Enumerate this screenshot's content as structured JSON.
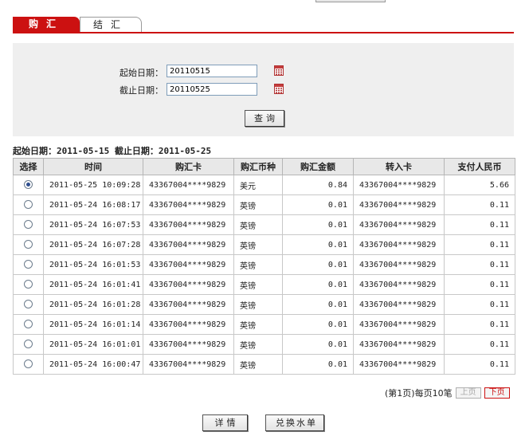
{
  "tabs": [
    {
      "label": "购汇",
      "active": true
    },
    {
      "label": "结汇",
      "active": false
    }
  ],
  "query": {
    "start_label": "起始日期：",
    "start_value": "20110515",
    "end_label": "截止日期：",
    "end_value": "20110525",
    "query_button": "查询"
  },
  "summary": {
    "start_label": "起始日期：",
    "start_value": "2011-05-15",
    "end_label": "截止日期：",
    "end_value": "2011-05-25"
  },
  "table": {
    "headers": [
      "选择",
      "时间",
      "购汇卡",
      "购汇币种",
      "购汇金额",
      "转入卡",
      "支付人民币"
    ],
    "rows": [
      {
        "selected": true,
        "time": "2011-05-25 10:09:28",
        "card": "43367004****9829",
        "currency": "美元",
        "amount": "0.84",
        "to_card": "43367004****9829",
        "rmb": "5.66"
      },
      {
        "selected": false,
        "time": "2011-05-24 16:08:17",
        "card": "43367004****9829",
        "currency": "英镑",
        "amount": "0.01",
        "to_card": "43367004****9829",
        "rmb": "0.11"
      },
      {
        "selected": false,
        "time": "2011-05-24 16:07:53",
        "card": "43367004****9829",
        "currency": "英镑",
        "amount": "0.01",
        "to_card": "43367004****9829",
        "rmb": "0.11"
      },
      {
        "selected": false,
        "time": "2011-05-24 16:07:28",
        "card": "43367004****9829",
        "currency": "英镑",
        "amount": "0.01",
        "to_card": "43367004****9829",
        "rmb": "0.11"
      },
      {
        "selected": false,
        "time": "2011-05-24 16:01:53",
        "card": "43367004****9829",
        "currency": "英镑",
        "amount": "0.01",
        "to_card": "43367004****9829",
        "rmb": "0.11"
      },
      {
        "selected": false,
        "time": "2011-05-24 16:01:41",
        "card": "43367004****9829",
        "currency": "英镑",
        "amount": "0.01",
        "to_card": "43367004****9829",
        "rmb": "0.11"
      },
      {
        "selected": false,
        "time": "2011-05-24 16:01:28",
        "card": "43367004****9829",
        "currency": "英镑",
        "amount": "0.01",
        "to_card": "43367004****9829",
        "rmb": "0.11"
      },
      {
        "selected": false,
        "time": "2011-05-24 16:01:14",
        "card": "43367004****9829",
        "currency": "英镑",
        "amount": "0.01",
        "to_card": "43367004****9829",
        "rmb": "0.11"
      },
      {
        "selected": false,
        "time": "2011-05-24 16:01:01",
        "card": "43367004****9829",
        "currency": "英镑",
        "amount": "0.01",
        "to_card": "43367004****9829",
        "rmb": "0.11"
      },
      {
        "selected": false,
        "time": "2011-05-24 16:00:47",
        "card": "43367004****9829",
        "currency": "英镑",
        "amount": "0.01",
        "to_card": "43367004****9829",
        "rmb": "0.11"
      }
    ]
  },
  "pager": {
    "info": "(第1页)每页10笔",
    "prev_label": "上页",
    "next_label": "下页"
  },
  "actions": {
    "detail_label": "详情",
    "receipt_label": "兑换水单"
  },
  "icons": {
    "calendar": "calendar-icon",
    "radio": "radio-icon"
  },
  "colors": {
    "accent": "#cc1111",
    "panel_bg": "#efefef",
    "header_bg": "#e8e8e8"
  }
}
